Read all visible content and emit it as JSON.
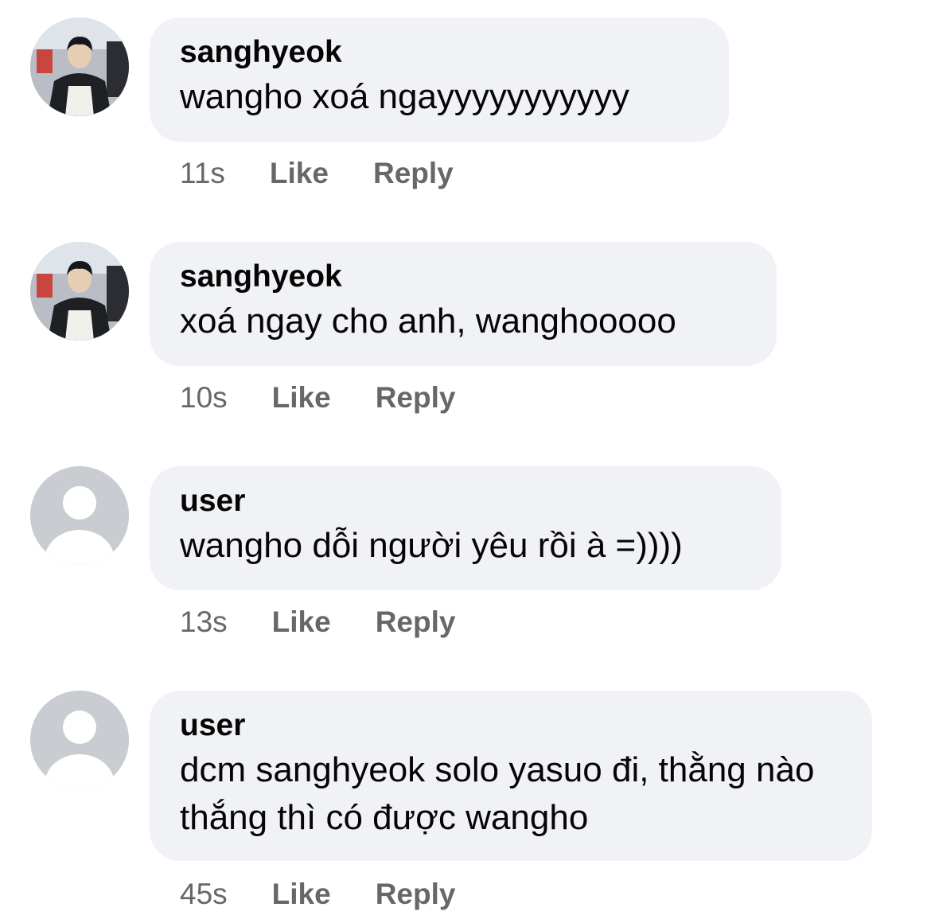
{
  "comments": [
    {
      "author": "sanghyeok",
      "avatar": "photo-avatar",
      "text": "wangho xoá ngayyyyyyyyyyy",
      "time": "11s",
      "like_label": "Like",
      "reply_label": "Reply"
    },
    {
      "author": "sanghyeok",
      "avatar": "photo-avatar",
      "text": "xoá ngay cho anh, wanghooooo",
      "time": "10s",
      "like_label": "Like",
      "reply_label": "Reply"
    },
    {
      "author": "user",
      "avatar": "default-avatar-icon",
      "text": "wangho dỗi người yêu rồi à =))))",
      "time": "13s",
      "like_label": "Like",
      "reply_label": "Reply"
    },
    {
      "author": "user",
      "avatar": "default-avatar-icon",
      "text": "dcm sanghyeok solo yasuo đi, thằng nào thắng thì có được wangho",
      "time": "45s",
      "like_label": "Like",
      "reply_label": "Reply"
    }
  ],
  "colors": {
    "bubble": "#f0f2f5",
    "text": "#050505",
    "meta": "#65676b",
    "default_avatar_bg": "#c9ccd1"
  }
}
